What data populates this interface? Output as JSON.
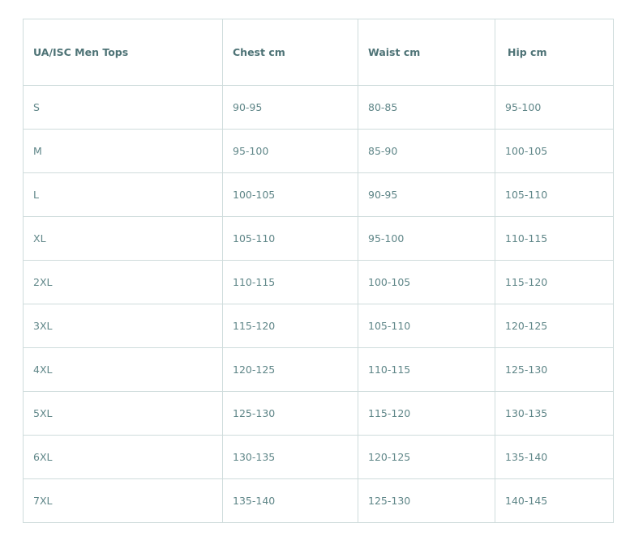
{
  "table": {
    "headers": [
      "UA/ISC Men Tops",
      "Chest cm",
      "Waist cm",
      "Hip cm"
    ],
    "rows": [
      [
        "S",
        "90-95",
        "80-85",
        "95-100"
      ],
      [
        "M",
        "95-100",
        "85-90",
        "100-105"
      ],
      [
        "L",
        "100-105",
        "90-95",
        "105-110"
      ],
      [
        "XL",
        "105-110",
        "95-100",
        "110-115"
      ],
      [
        "2XL",
        "110-115",
        "100-105",
        "115-120"
      ],
      [
        "3XL",
        "115-120",
        "105-110",
        "120-125"
      ],
      [
        "4XL",
        "120-125",
        "110-115",
        "125-130"
      ],
      [
        "5XL",
        "125-130",
        "115-120",
        "130-135"
      ],
      [
        "6XL",
        "130-135",
        "120-125",
        "135-140"
      ],
      [
        "7XL",
        "135-140",
        "125-130",
        "140-145"
      ]
    ]
  },
  "colors": {
    "text": "#5f8688",
    "header_text": "#4e7376",
    "border": "#cfdcdc",
    "background": "#ffffff"
  }
}
